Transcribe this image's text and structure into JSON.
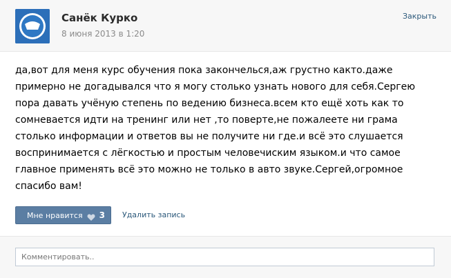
{
  "post": {
    "author": "Санёк Курко",
    "date": "8 июня 2013 в 1:20",
    "close_label": "Закрыть",
    "text": "да,вот для меня курс обучения пока закончелься,аж грустно както.даже примерно не догадывался что я могу столько узнать нового для себя.Сергею пора давать учёную степень по ведению бизнеса.всем кто ещё хоть как то сомневается идти на тренинг или нет ,то поверте,не пожалеете ни грама столько информации и ответов вы не получите ни где.и всё это слушается воспринимается с лёгкостью и простым человечиским языком.и что самое главное применять всё это можно не только в авто звуке.Сергей,огромное спасибо вам!"
  },
  "actions": {
    "like_label": "Мне нравится",
    "like_count": "3",
    "delete_label": "Удалить запись"
  },
  "comment": {
    "placeholder": "Комментировать.."
  },
  "colors": {
    "button": "#5b7ea3",
    "link": "#2b587a",
    "header_bg": "#f7f7f7"
  },
  "icons": {
    "avatar": "team-logo-avatar",
    "like": "heart-icon"
  }
}
